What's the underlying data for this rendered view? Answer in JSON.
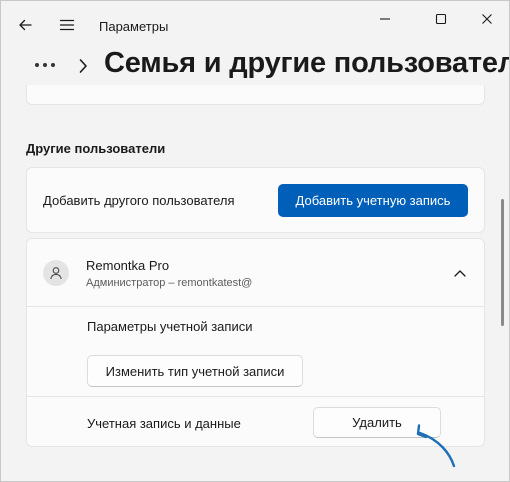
{
  "window": {
    "title": "Параметры"
  },
  "header": {
    "title": "Семья и другие пользователи"
  },
  "other_users": {
    "section_title": "Другие пользователи",
    "add_label": "Добавить другого пользователя",
    "add_button": "Добавить учетную запись"
  },
  "user": {
    "name": "Remontka Pro",
    "role": "Администратор – remontkatest@",
    "account_options_label": "Параметры учетной записи",
    "change_type_button": "Изменить тип учетной записи",
    "data_label": "Учетная запись и данные",
    "delete_button": "Удалить"
  },
  "colors": {
    "accent": "#005fb8",
    "annotation_arrow": "#1e6fb5"
  },
  "icons": [
    "back-arrow-icon",
    "hamburger-menu-icon",
    "minimize-icon",
    "maximize-icon",
    "close-icon",
    "more-dots-icon",
    "chevron-right-icon",
    "user-avatar-icon",
    "chevron-up-icon"
  ]
}
